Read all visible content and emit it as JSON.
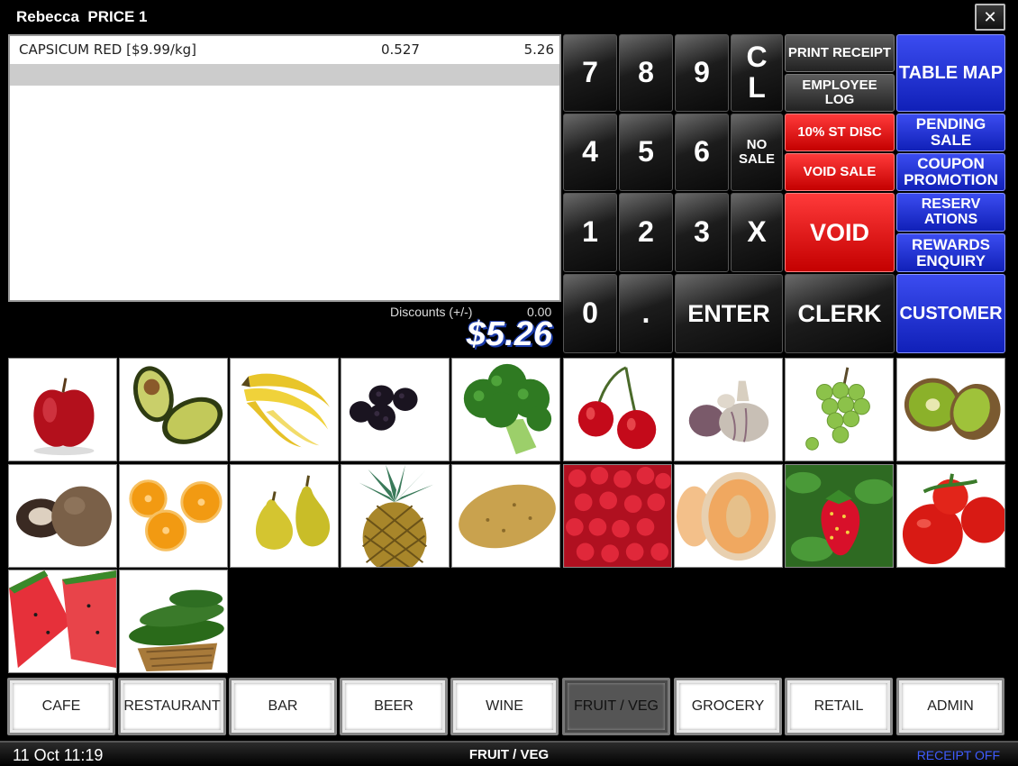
{
  "window": {
    "title": "Rebecca  PRICE 1",
    "close_glyph": "✕"
  },
  "receipt": {
    "items": [
      {
        "name": "CAPSICUM RED [$9.99/kg]",
        "qty": "0.527",
        "amount": "5.26"
      }
    ],
    "discount_label": "Discounts (+/-)",
    "discount_value": "0.00",
    "total": "$5.26"
  },
  "keypad": {
    "k7": "7",
    "k8": "8",
    "k9": "9",
    "clear": "C\nL",
    "k4": "4",
    "k5": "5",
    "k6": "6",
    "no_sale": "NO\nSALE",
    "k1": "1",
    "k2": "2",
    "k3": "3",
    "multiply": "X",
    "k0": "0",
    "decimal": ".",
    "enter": "ENTER",
    "clerk": "CLERK"
  },
  "functions": {
    "print_receipt": "PRINT RECEIPT",
    "employee_log": "EMPLOYEE\nLOG",
    "st_disc": "10% ST DISC",
    "void_sale": "VOID SALE",
    "void": "VOID",
    "table_map": "TABLE MAP",
    "pending_sale": "PENDING\nSALE",
    "coupon_promotion": "COUPON\nPROMOTION",
    "reservations": "RESERV\nATIONS",
    "rewards_enquiry": "REWARDS\nENQUIRY",
    "customer": "CUSTOMER"
  },
  "products": [
    {
      "icon": "apple-icon"
    },
    {
      "icon": "avocado-icon"
    },
    {
      "icon": "banana-icon"
    },
    {
      "icon": "blackberry-icon"
    },
    {
      "icon": "broccoli-icon"
    },
    {
      "icon": "cherry-icon"
    },
    {
      "icon": "garlic-icon"
    },
    {
      "icon": "grapes-icon"
    },
    {
      "icon": "kiwi-icon"
    },
    {
      "icon": "mushroom-icon"
    },
    {
      "icon": "orange-icon"
    },
    {
      "icon": "pear-icon"
    },
    {
      "icon": "pineapple-icon"
    },
    {
      "icon": "potato-icon"
    },
    {
      "icon": "raspberry-icon"
    },
    {
      "icon": "melon-icon"
    },
    {
      "icon": "strawberry-icon"
    },
    {
      "icon": "tomato-icon"
    },
    {
      "icon": "watermelon-icon"
    },
    {
      "icon": "zucchini-icon"
    }
  ],
  "categories": [
    {
      "label": "CAFE"
    },
    {
      "label": "RESTAURANT"
    },
    {
      "label": "BAR"
    },
    {
      "label": "BEER"
    },
    {
      "label": "WINE"
    },
    {
      "label": "FRUIT / VEG"
    },
    {
      "label": "GROCERY"
    },
    {
      "label": "RETAIL"
    },
    {
      "label": "ADMIN"
    }
  ],
  "active_category": "FRUIT / VEG",
  "status": {
    "datetime": "11 Oct 11:19",
    "current_category": "FRUIT / VEG",
    "receipt_mode": "RECEIPT OFF"
  },
  "colors": {
    "red_key": "#e00000",
    "blue_key": "#1a2ad6",
    "status_blue": "#3f5cff"
  }
}
